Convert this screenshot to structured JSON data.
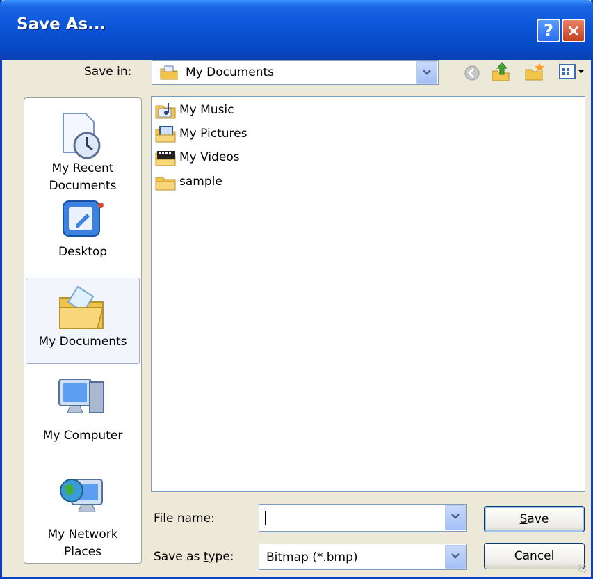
{
  "window": {
    "title": "Save As...",
    "help_label": "?",
    "close_label": "×"
  },
  "toolbar": {
    "save_in_label": "Save in:",
    "save_in_value": "My Documents",
    "back_icon": "back-arrow-icon",
    "up_icon": "up-folder-icon",
    "new_folder_icon": "new-folder-icon",
    "views_icon": "views-menu-icon"
  },
  "places": [
    {
      "label_line1": "My Recent",
      "label_line2": "Documents",
      "icon": "recent-documents-icon"
    },
    {
      "label_line1": "Desktop",
      "label_line2": "",
      "icon": "desktop-icon"
    },
    {
      "label_line1": "My Documents",
      "label_line2": "",
      "icon": "my-documents-icon",
      "selected": true
    },
    {
      "label_line1": "My Computer",
      "label_line2": "",
      "icon": "my-computer-icon"
    },
    {
      "label_line1": "My Network",
      "label_line2": "Places",
      "icon": "network-places-icon"
    }
  ],
  "files": [
    {
      "name": "My Music",
      "icon": "music-folder-icon"
    },
    {
      "name": "My Pictures",
      "icon": "pictures-folder-icon"
    },
    {
      "name": "My Videos",
      "icon": "videos-folder-icon"
    },
    {
      "name": "sample",
      "icon": "folder-icon"
    }
  ],
  "filename": {
    "label_pre": "File ",
    "label_mnemonic": "n",
    "label_post": "ame:",
    "value": ""
  },
  "filetype": {
    "label_pre": "Save as ",
    "label_mnemonic": "t",
    "label_post": "ype:",
    "value": "Bitmap (*.bmp)"
  },
  "buttons": {
    "save_mnemonic": "S",
    "save_rest": "ave",
    "cancel": "Cancel"
  },
  "colors": {
    "titlebar": "#0a55d8",
    "dialog_bg": "#ece9d8",
    "close_red": "#c6411f"
  }
}
